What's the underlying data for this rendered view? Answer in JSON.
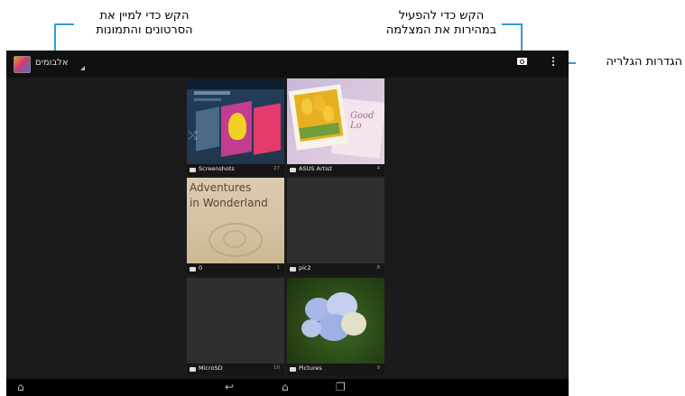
{
  "callouts": {
    "sort_line1": "הקש כדי למיין את",
    "sort_line2": "הסרטונים והתמונות",
    "camera_line1": "הקש כדי להפעיל",
    "camera_line2": "במהירות את המצלמה",
    "settings": "הגדרות הגלריה"
  },
  "actionbar": {
    "dropdown_label": "אלבומים"
  },
  "albums": [
    {
      "name": "Screenshots",
      "count": "27"
    },
    {
      "name": "ASUS Artist",
      "count": "4"
    },
    {
      "name": "0",
      "count": "1"
    },
    {
      "name": "pic2",
      "count": "8"
    },
    {
      "name": "MicroSD",
      "count": "10"
    },
    {
      "name": "Pictures",
      "count": "9"
    }
  ],
  "thumb_texts": {
    "wonderland_line1": "Adventures",
    "wonderland_line2": "in Wonderland",
    "card_text": "Good Lo"
  },
  "colors": {
    "callout_accent": "#2f9bd8",
    "screen_bg": "#1b1b1b"
  },
  "icons": {
    "camera": "camera-icon",
    "overflow": "overflow-menu-icon",
    "folder": "folder-icon",
    "back": "back-icon",
    "home": "home-icon",
    "recents": "recent-apps-icon",
    "hide_nav": "hide-nav-icon"
  }
}
